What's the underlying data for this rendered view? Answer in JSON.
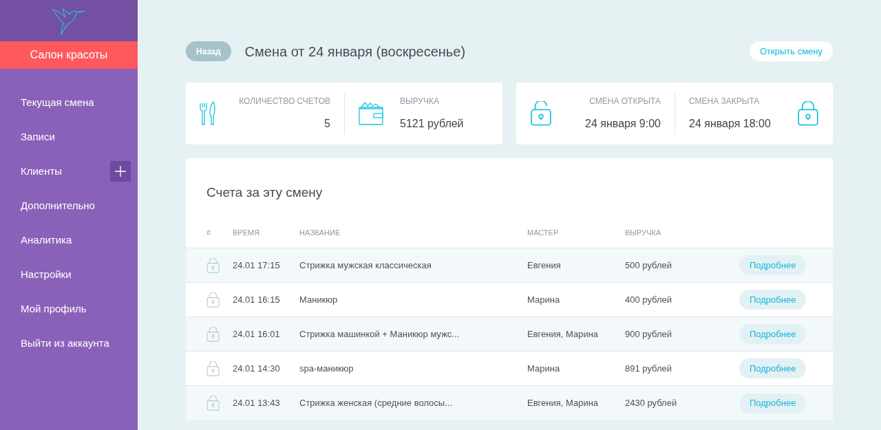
{
  "sidebar": {
    "brand": "Салон красоты",
    "items": [
      {
        "label": "Текущая смена",
        "has_add": false
      },
      {
        "label": "Записи",
        "has_add": false
      },
      {
        "label": "Клиенты",
        "has_add": true
      },
      {
        "label": "Дополнительно",
        "has_add": false
      },
      {
        "label": "Аналитика",
        "has_add": false
      },
      {
        "label": "Настройки",
        "has_add": false
      },
      {
        "label": "Мой профиль",
        "has_add": false
      },
      {
        "label": "Выйти из аккаунта",
        "has_add": false
      }
    ]
  },
  "header": {
    "back": "Назад",
    "title": "Смена от 24 января (воскресенье)",
    "action": "Открыть смену"
  },
  "stats": [
    {
      "kind": "count",
      "label": "КОЛИЧЕСТВО СЧЕТОВ",
      "value": "5"
    },
    {
      "kind": "revenue",
      "label": "ВЫРУЧКА",
      "value": "5121 рублей"
    }
  ],
  "shift": [
    {
      "kind": "opened",
      "label": "СМЕНА ОТКРЫТА",
      "value": "24 января 9:00"
    },
    {
      "kind": "closed",
      "label": "СМЕНА ЗАКРЫТА",
      "value": "24 января 18:00"
    }
  ],
  "table": {
    "title": "Счета за эту смену",
    "columns": [
      "#",
      "ВРЕМЯ",
      "НАЗВАНИЕ",
      "МАСТЕР",
      "ВЫРУЧКА"
    ],
    "rows": [
      {
        "time": "24.01 17:15",
        "name": "Стрижка мужская классическая",
        "master": "Евгения",
        "revenue": "500 рублей",
        "action": "Подробнее"
      },
      {
        "time": "24.01 16:15",
        "name": "Маникюр",
        "master": "Марина",
        "revenue": "400 рублей",
        "action": "Подробнее"
      },
      {
        "time": "24.01 16:01",
        "name": "Стрижка машинкой + Маникюр мужс...",
        "master": "Евгения, Марина",
        "revenue": "900 рублей",
        "action": "Подробнее"
      },
      {
        "time": "24.01 14:30",
        "name": "spa-маникюр",
        "master": "Марина",
        "revenue": "891 рублей",
        "action": "Подробнее"
      },
      {
        "time": "24.01 13:43",
        "name": "Стрижка женская (средние волосы...",
        "master": "Евгения, Марина",
        "revenue": "2430 рублей",
        "action": "Подробнее"
      }
    ]
  }
}
